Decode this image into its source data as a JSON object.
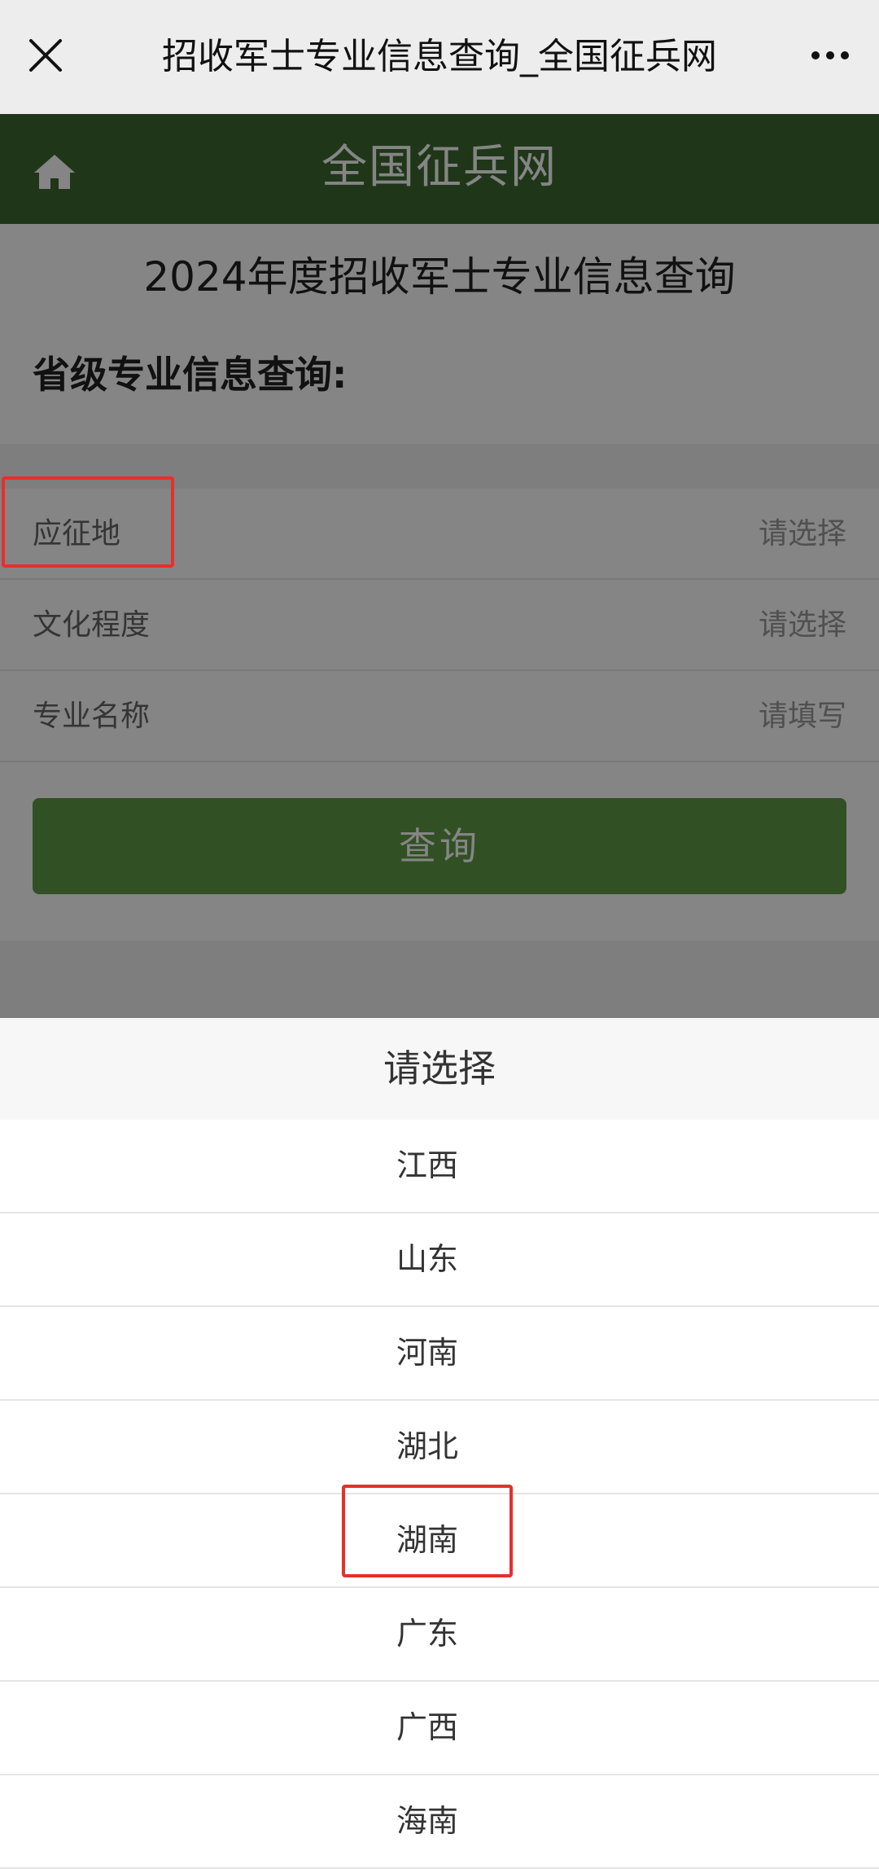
{
  "topbar": {
    "title": "招收军士专业信息查询_全国征兵网",
    "close_icon": "close-icon",
    "more_icon": "more-icon"
  },
  "header": {
    "site_name": "全国征兵网",
    "home_icon": "home-icon",
    "background_color": "#3d6a2f"
  },
  "main": {
    "page_title": "2024年度招收军士专业信息查询",
    "section_title": "省级专业信息查询:",
    "form": [
      {
        "label": "应征地",
        "value": "请选择"
      },
      {
        "label": "文化程度",
        "value": "请选择"
      },
      {
        "label": "专业名称",
        "value": "请填写"
      }
    ],
    "query_button": "查询"
  },
  "picker": {
    "title": "请选择",
    "options": [
      "江西",
      "山东",
      "河南",
      "湖北",
      "湖南",
      "广东",
      "广西",
      "海南"
    ]
  },
  "colors": {
    "brand_green": "#3d6a2f",
    "button_green": "#5f9a46",
    "annotation_red": "#e6302a"
  }
}
